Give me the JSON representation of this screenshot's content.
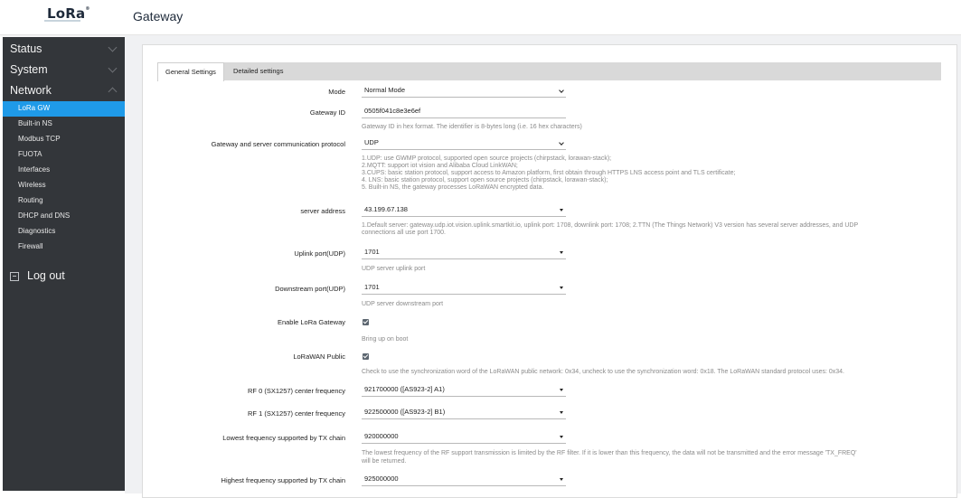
{
  "app": {
    "logo": "LoRa",
    "logo_mark": "®",
    "title": "Gateway"
  },
  "sidebar": {
    "groups": [
      {
        "label": "Status"
      },
      {
        "label": "System"
      },
      {
        "label": "Network"
      }
    ],
    "items": [
      {
        "label": "LoRa GW",
        "active": true
      },
      {
        "label": "Built-in NS"
      },
      {
        "label": "Modbus TCP"
      },
      {
        "label": "FUOTA"
      },
      {
        "label": "Interfaces"
      },
      {
        "label": "Wireless"
      },
      {
        "label": "Routing"
      },
      {
        "label": "DHCP and DNS"
      },
      {
        "label": "Diagnostics"
      },
      {
        "label": "Firewall"
      }
    ],
    "logout": "Log out"
  },
  "tabs": [
    {
      "label": "General Settings",
      "active": true
    },
    {
      "label": "Detailed settings"
    }
  ],
  "form": {
    "mode": {
      "label": "Mode",
      "value": "Normal Mode"
    },
    "gateway_id": {
      "label": "Gateway ID",
      "value": "0505f041c8e3e6ef",
      "hint": "Gateway ID in hex format. The identifier is 8-bytes long (i.e. 16 hex characters)"
    },
    "protocol": {
      "label": "Gateway and server communication protocol",
      "value": "UDP",
      "hints": [
        "1.UDP: use GWMP protocol, supported open source projects (chirpstack, lorawan-stack);",
        "2.MQTT: support iot vision and Alibaba Cloud LinkWAN;",
        "3.CUPS: basic station protocol, support access to Amazon platform, first obtain through HTTPS LNS access point and TLS certificate;",
        "4. LNS: basic station protocol, support open source projects (chirpstack, lorawan-stack);",
        "5. Built-in NS, the gateway processes LoRaWAN encrypted data."
      ]
    },
    "server": {
      "label": "server address",
      "value": "43.199.67.138",
      "hints": [
        "1.Default server: gateway.udp.iot.vision.uplink.smartkit.io, uplink port: 1708, downlink port: 1708; 2.TTN (The Things Network) V3 version has several server addresses, and UDP",
        "connections all use port 1700."
      ]
    },
    "uplink": {
      "label": "Uplink port(UDP)",
      "value": "1701",
      "hint": "UDP server uplink port"
    },
    "downlink": {
      "label": "Downstream port(UDP)",
      "value": "1701",
      "hint": "UDP server downstream port"
    },
    "enable": {
      "label": "Enable LoRa Gateway",
      "checked": true,
      "hint": "Bring up on boot"
    },
    "public": {
      "label": "LoRaWAN Public",
      "checked": true,
      "hint": "Check to use the synchronization word of the LoRaWAN public network: 0x34, uncheck to use the synchronization word: 0x18. The LoRaWAN standard protocol uses: 0x34."
    },
    "rf0": {
      "label": "RF 0 (SX1257) center frequency",
      "value": "921700000 ([AS923-2] A1)"
    },
    "rf1": {
      "label": "RF 1 (SX1257) center frequency",
      "value": "922500000 ([AS923-2] B1)"
    },
    "lowest": {
      "label": "Lowest frequency supported by TX chain",
      "value": "920000000",
      "hints": [
        "The lowest frequency of the RF support transmission is limited by the RF filter. If it is lower than this frequency, the data will not be transmitted and the error message 'TX_FREQ'",
        "will be returned."
      ]
    },
    "highest": {
      "label": "Highest frequency supported by TX chain",
      "value": "925000000"
    }
  },
  "colors": {
    "sidebar_bg": "#33363a",
    "active_item": "#1f9ae8",
    "tabs_bg": "#d9d9d9"
  }
}
